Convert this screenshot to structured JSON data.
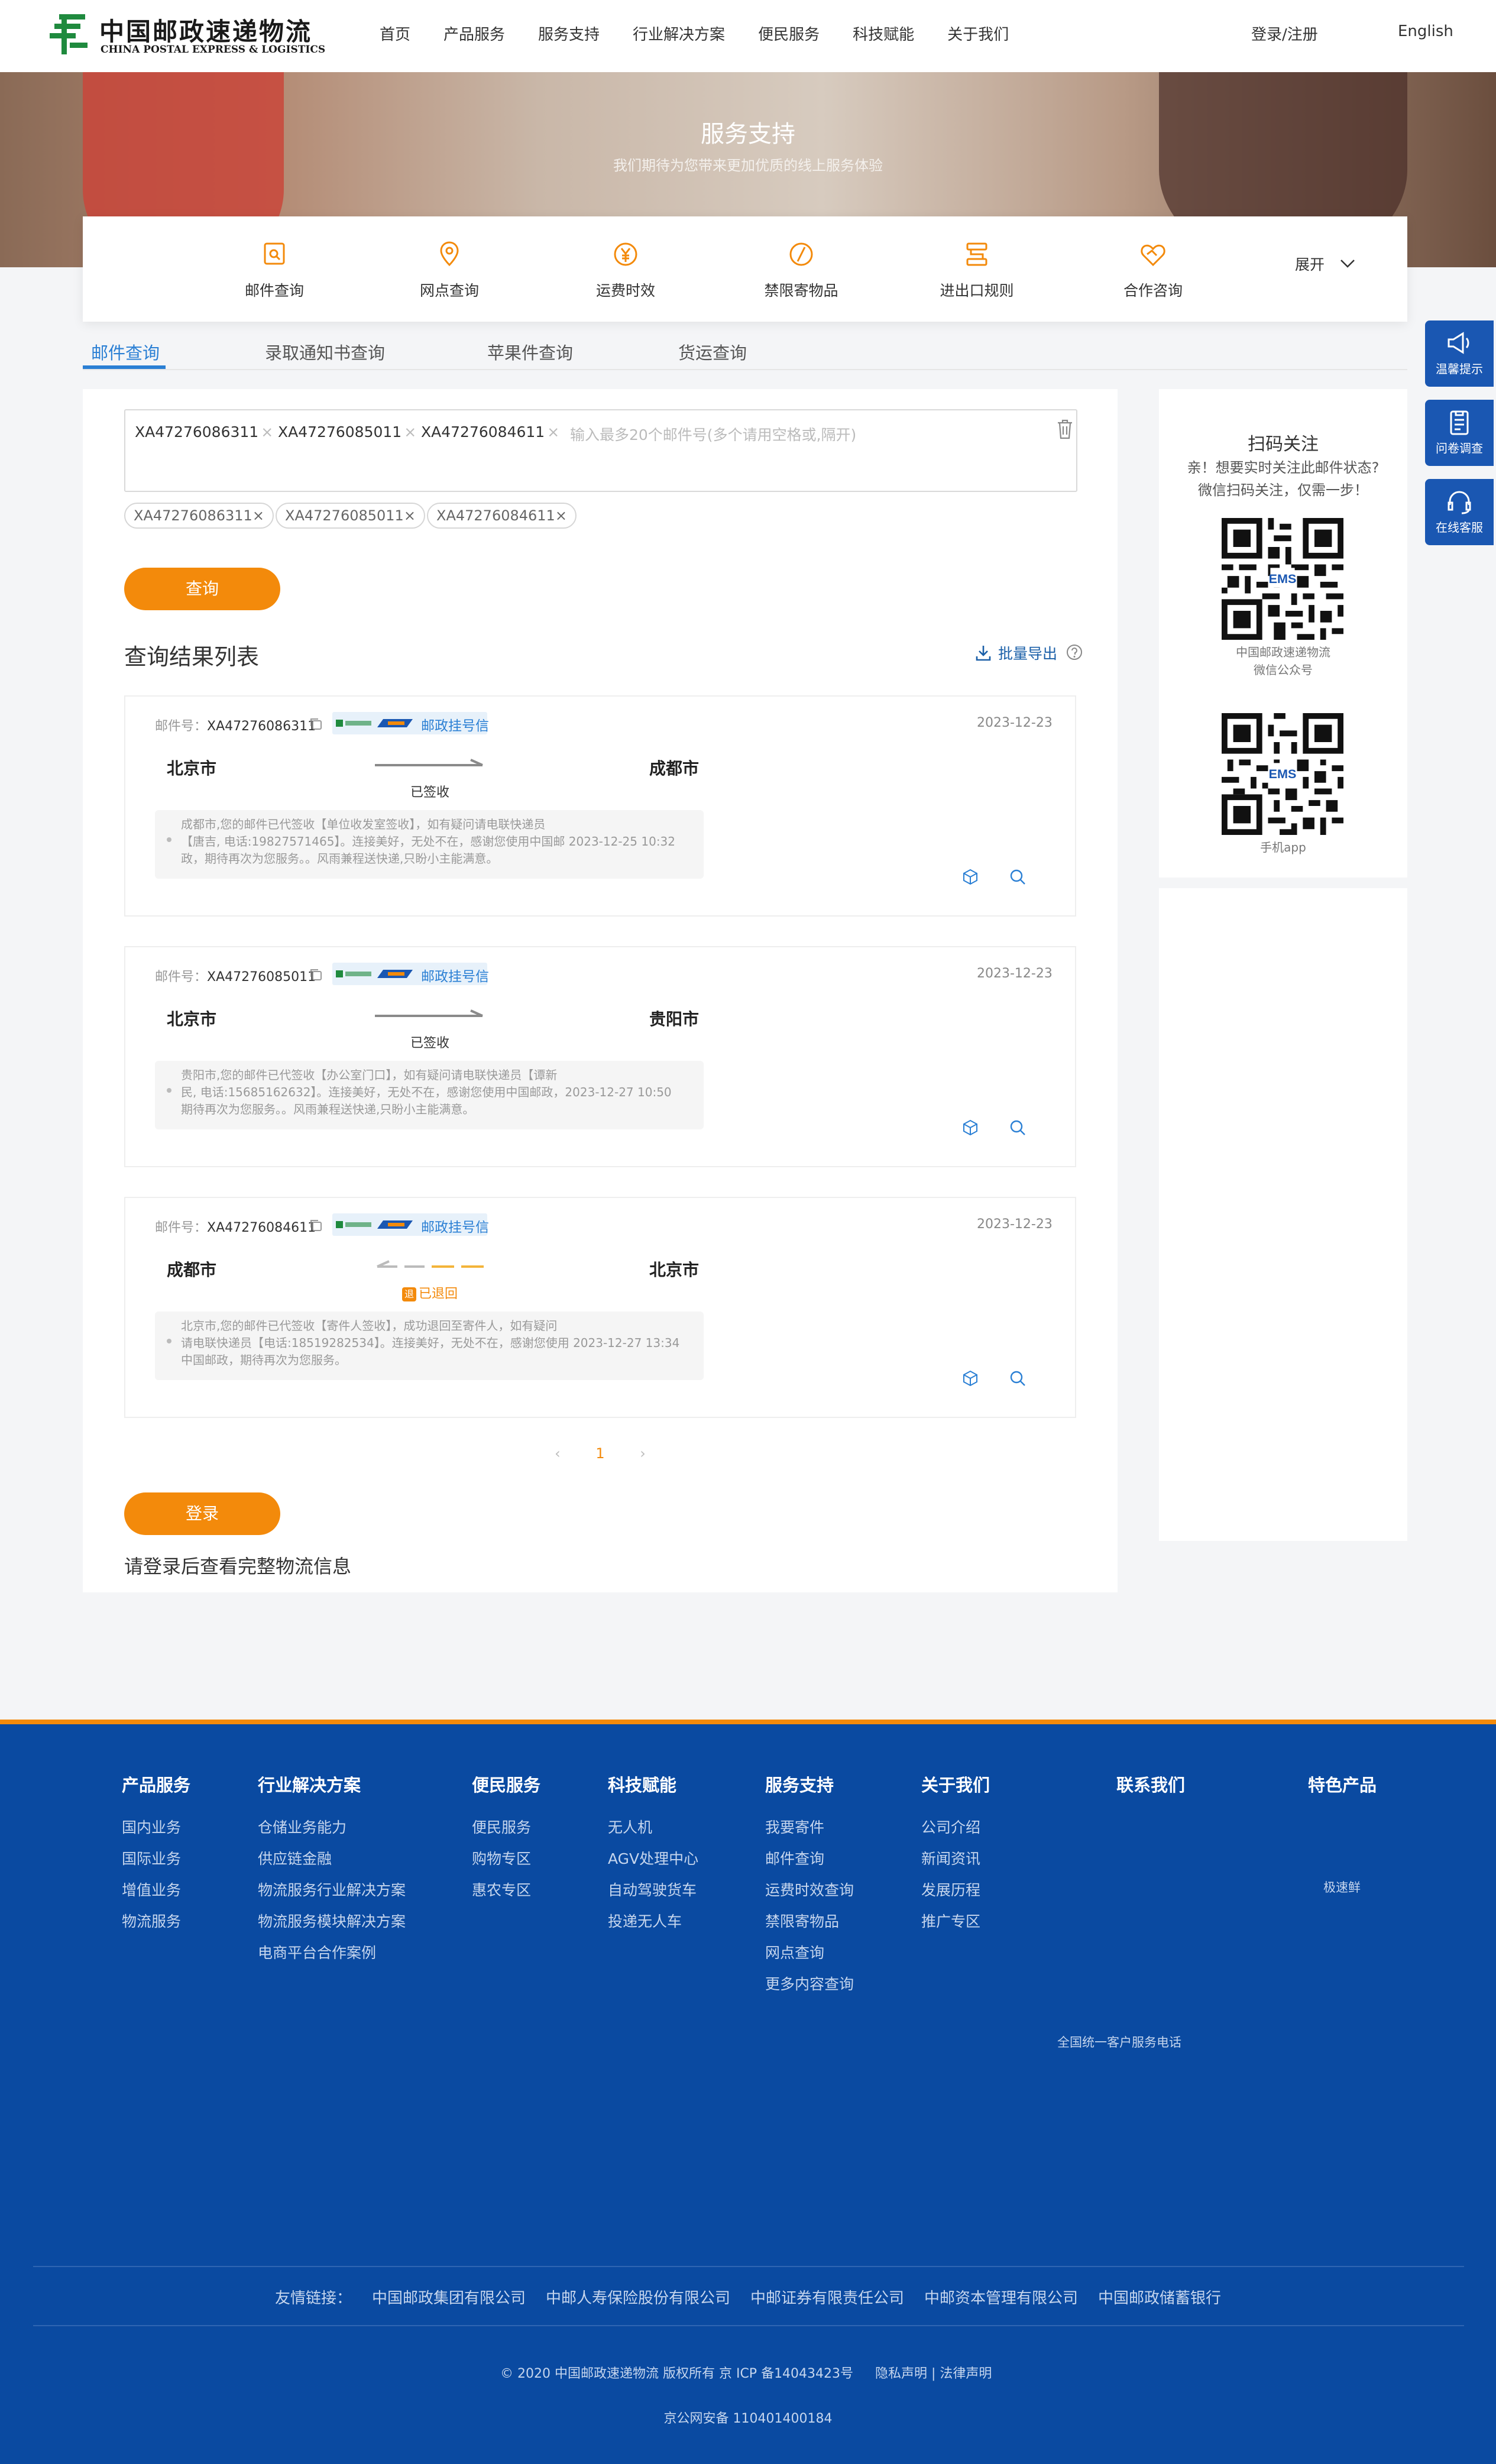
{
  "header": {
    "logo_cn": "中国邮政速递物流",
    "logo_en": "CHINA POSTAL EXPRESS & LOGISTICS",
    "nav": [
      "首页",
      "产品服务",
      "服务支持",
      "行业解决方案",
      "便民服务",
      "科技赋能",
      "关于我们"
    ],
    "login": "登录/注册",
    "lang": "English"
  },
  "banner": {
    "title": "服务支持",
    "subtitle": "我们期待为您带来更加优质的线上服务体验"
  },
  "services": {
    "items": [
      {
        "label": "邮件查询",
        "icon": "mail-search-icon"
      },
      {
        "label": "网点查询",
        "icon": "location-pin-icon"
      },
      {
        "label": "运费时效",
        "icon": "yuan-coin-icon"
      },
      {
        "label": "禁限寄物品",
        "icon": "forbidden-icon"
      },
      {
        "label": "进出口规则",
        "icon": "import-export-icon"
      },
      {
        "label": "合作咨询",
        "icon": "handshake-icon"
      }
    ],
    "expand": "展开"
  },
  "tabs": [
    "邮件查询",
    "录取通知书查询",
    "苹果件查询",
    "货运查询"
  ],
  "query": {
    "input_tags": [
      "XA47276086311",
      "XA47276085011",
      "XA47276084611"
    ],
    "placeholder": "输入最多20个邮件号(多个请用空格或,隔开)",
    "chips": [
      "XA47276086311×",
      "XA47276085011×",
      "XA47276084611×"
    ],
    "button": "查询"
  },
  "results": {
    "title": "查询结果列表",
    "export": "批量导出",
    "mail_label": "邮件号：",
    "badge": "邮政挂号信",
    "items": [
      {
        "mail_no": "XA47276086311",
        "date": "2023-12-23",
        "from": "北京市",
        "to": "成都市",
        "status": "已签收",
        "detail": [
          "成都市,您的邮件已代签收【单位收发室签收】，如有疑问请电联快递员",
          "【唐吉, 电话:19827571465】。连接美好，无处不在，感谢您使用中国邮 2023-12-25 10:32",
          "政，期待再次为您服务。。风雨兼程送快递,只盼小主能满意。"
        ]
      },
      {
        "mail_no": "XA47276085011",
        "date": "2023-12-23",
        "from": "北京市",
        "to": "贵阳市",
        "status": "已签收",
        "detail": [
          "贵阳市,您的邮件已代签收【办公室门口】，如有疑问请电联快递员【谭新",
          "民, 电话:15685162632】。连接美好，无处不在，感谢您使用中国邮政，2023-12-27 10:50",
          "期待再次为您服务。。风雨兼程送快递,只盼小主能满意。"
        ]
      },
      {
        "mail_no": "XA47276084611",
        "date": "2023-12-23",
        "from": "成都市",
        "to": "北京市",
        "status": "已退回",
        "detail": [
          "北京市,您的邮件已代签收【寄件人签收】，成功退回至寄件人，如有疑问",
          "请电联快递员【电话:18519282534】。连接美好，无处不在，感谢您使用 2023-12-27 13:34",
          "中国邮政，期待再次为您服务。"
        ]
      }
    ]
  },
  "pager": {
    "prev": "‹",
    "current": "1",
    "next": "›"
  },
  "login_button": "登录",
  "login_tip": "请登录后查看完整物流信息",
  "qr": {
    "title": "扫码关注",
    "desc1": "亲！想要实时关注此邮件状态?",
    "desc2": "微信扫码关注，仅需一步！",
    "cap1a": "中国邮政速递物流",
    "cap1b": "微信公众号",
    "cap2": "手机app"
  },
  "float": [
    "温馨提示",
    "问卷调查",
    "在线客服"
  ],
  "footer": {
    "columns": [
      {
        "head": "产品服务",
        "links": [
          "国内业务",
          "国际业务",
          "增值业务",
          "物流服务"
        ]
      },
      {
        "head": "行业解决方案",
        "links": [
          "仓储业务能力",
          "供应链金融",
          "物流服务行业解决方案",
          "物流服务模块解决方案",
          "电商平台合作案例"
        ]
      },
      {
        "head": "便民服务",
        "links": [
          "便民服务",
          "购物专区",
          "惠农专区"
        ]
      },
      {
        "head": "科技赋能",
        "links": [
          "无人机",
          "AGV处理中心",
          "自动驾驶货车",
          "投递无人车"
        ]
      },
      {
        "head": "服务支持",
        "links": [
          "我要寄件",
          "邮件查询",
          "运费时效查询",
          "禁限寄物品",
          "网点查询",
          "更多内容查询"
        ]
      },
      {
        "head": "关于我们",
        "links": [
          "公司介绍",
          "新闻资讯",
          "发展历程",
          "推广专区"
        ]
      },
      {
        "head": "联系我们",
        "links": []
      },
      {
        "head": "特色产品",
        "links": []
      }
    ],
    "special": "极速鲜",
    "hotline": "全国统一客户服务电话",
    "friends_label": "友情链接：",
    "friends": [
      "中国邮政集团有限公司",
      "中邮人寿保险股份有限公司",
      "中邮证券有限责任公司",
      "中邮资本管理有限公司",
      "中国邮政储蓄银行"
    ],
    "copyright": "© 2020 中国邮政速递物流 版权所有 京 ICP 备14043423号",
    "policy": "隐私声明 | 法律声明",
    "icp": "京公网安备 110401400184"
  },
  "colors": {
    "brand_blue": "#0a4aa1",
    "accent_orange": "#f38a0b",
    "link_blue": "#2a7fd4"
  }
}
